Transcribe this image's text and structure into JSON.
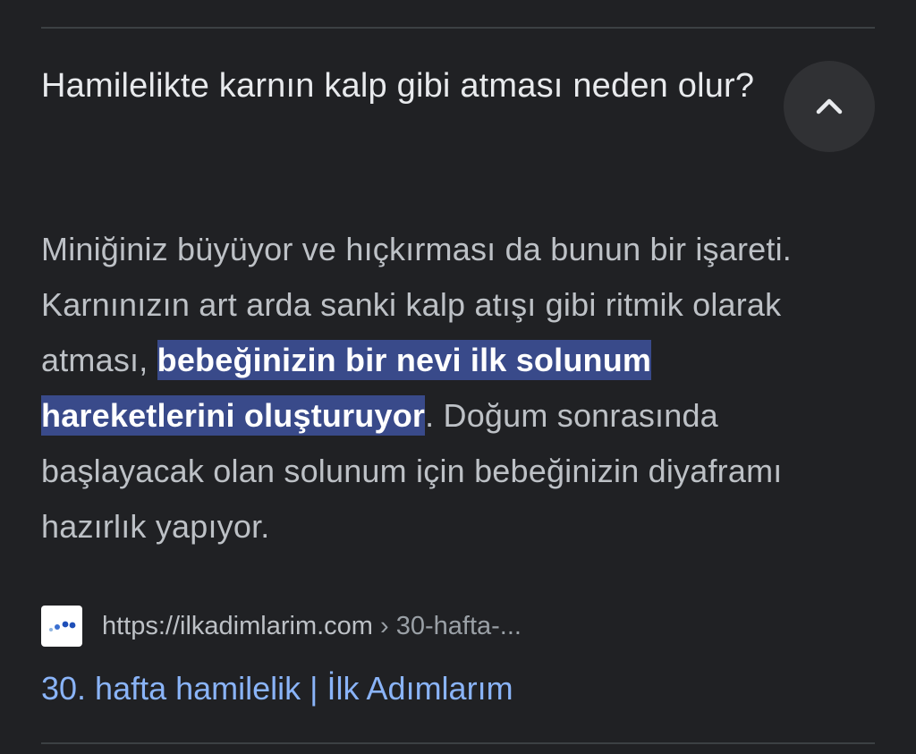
{
  "question": {
    "title": "Hamilelikte karnın kalp gibi atması neden olur?",
    "toggle_icon": "chevron-up-icon"
  },
  "answer": {
    "text_before": "Miniğiniz büyüyor ve hıçkırması da bunun bir işareti. Karnınızın art arda sanki kalp atışı gibi ritmik olarak atması, ",
    "highlighted": "bebeğinizin bir nevi ilk solunum hareketlerini oluşturuyor",
    "text_after": ". Doğum sonrasında başlayacak olan solunum için bebeğinizin diyaframı hazırlık yapıyor."
  },
  "source": {
    "favicon": "site-favicon",
    "url": "https://ilkadimlarim.com",
    "breadcrumb": " › 30-hafta-...",
    "title": "30. hafta hamilelik | İlk Adımlarım"
  },
  "colors": {
    "background": "#202124",
    "highlight": "#394a8a",
    "link": "#8ab4f8",
    "title_text": "#e8eaed",
    "body_text": "#bdc1c6"
  }
}
